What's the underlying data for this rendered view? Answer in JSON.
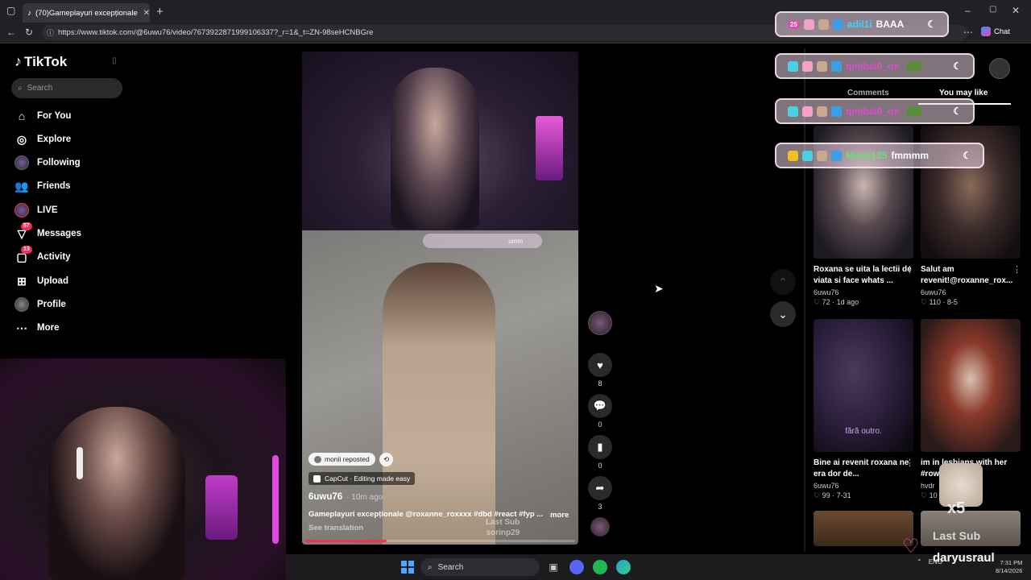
{
  "browser": {
    "tab_title": "(70)Gameplayuri excepționale",
    "url": "https://www.tiktok.com/@6uwu76/video/7673922871999106337?_r=1&_t=ZN-98seHCNBGre",
    "chat_label": "Chat"
  },
  "sidebar": {
    "logo": "TikTok",
    "search_placeholder": "Search",
    "items": [
      {
        "label": "For You",
        "icon": "home-icon"
      },
      {
        "label": "Explore",
        "icon": "compass-icon"
      },
      {
        "label": "Following",
        "icon": "avatar-icon"
      },
      {
        "label": "Friends",
        "icon": "friends-icon"
      },
      {
        "label": "LIVE",
        "icon": "live-icon"
      },
      {
        "label": "Messages",
        "icon": "messages-icon",
        "badge": "57"
      },
      {
        "label": "Activity",
        "icon": "activity-icon",
        "badge": "13"
      },
      {
        "label": "Upload",
        "icon": "upload-icon"
      },
      {
        "label": "Profile",
        "icon": "profile-icon"
      },
      {
        "label": "More",
        "icon": "more-icon"
      }
    ]
  },
  "video": {
    "repost_chip": "monii reposted",
    "capcut_chip": "CapCut · Editing made easy",
    "author": "6uwu76",
    "time": "· 10m ago",
    "caption": "Gameplayuri excepționale @roxanne_roxxxx #dbd #react #fyp ...",
    "more": "more",
    "see_translation": "See translation",
    "overlay_msg_1": "umm",
    "watermark_1": "Last Sub",
    "watermark_2": "sorinp29",
    "progress": 0.3
  },
  "rail": {
    "likes": "8",
    "comments": "0",
    "saves": "0",
    "shares": "3"
  },
  "right": {
    "tab_comments": "Comments",
    "tab_you_may_like": "You may like",
    "cards": [
      {
        "title": "Roxana se uita la lectii de viata si face whats ...",
        "user": "6uwu76",
        "meta": "♡ 72 · 1d ago"
      },
      {
        "title": "Salut am revenit!@roxanne_rox...",
        "user": "6uwu76",
        "meta": "♡ 110 · 8-5"
      },
      {
        "title": "Bine ai revenit roxana ne era dor de...",
        "user": "6uwu76",
        "meta": "♡ 99 · 7-31",
        "thumb_text": "fără outro."
      },
      {
        "title": "im in lesbians with her #row...",
        "user": "hvdr",
        "meta": "♡ 10"
      }
    ]
  },
  "chat_overlay": {
    "messages": [
      {
        "user": "adil1i",
        "text": "BAAA",
        "level": "25"
      },
      {
        "user": "qmihai0_ox",
        "text": ""
      },
      {
        "user": "qmihai0_ox",
        "text": ""
      },
      {
        "user": "Monii135",
        "text": "fmmmm"
      }
    ]
  },
  "stream_overlay": {
    "multiplier": "x5",
    "last_sub_label": "Last Sub",
    "last_sub_user": "daryusraul"
  },
  "taskbar": {
    "search": "Search",
    "lang": "ENG",
    "time": "7:31 PM",
    "date": "8/14/2026"
  }
}
